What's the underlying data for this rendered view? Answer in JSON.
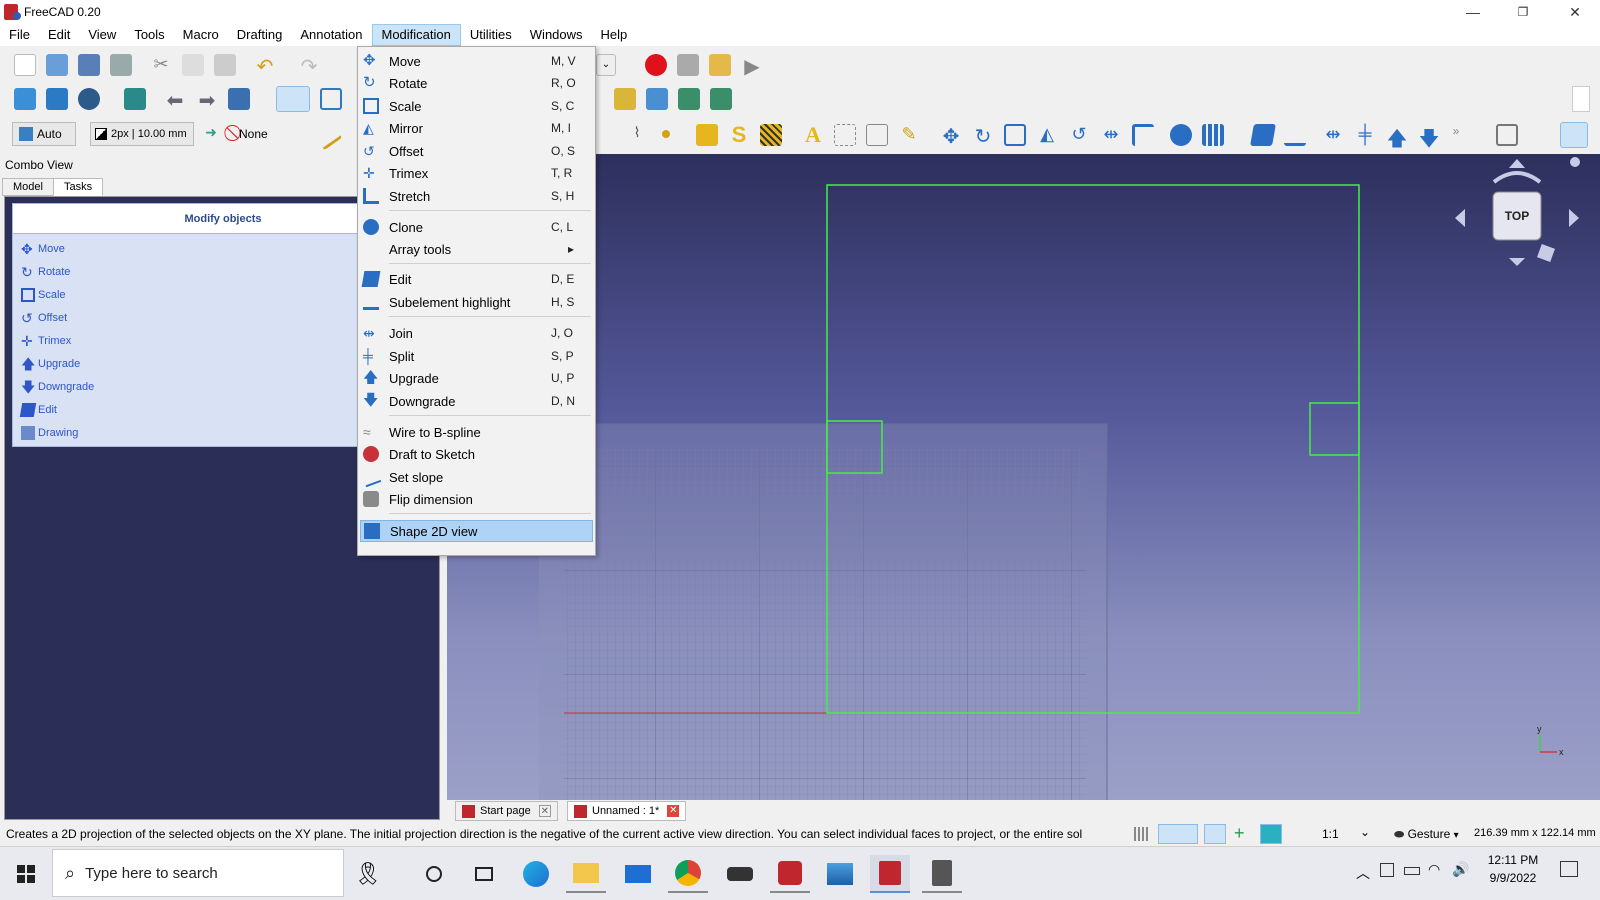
{
  "window": {
    "title": "FreeCAD 0.20",
    "minimize": "—",
    "restore": "❐",
    "close": "✕"
  },
  "menubar": [
    "File",
    "Edit",
    "View",
    "Tools",
    "Macro",
    "Drafting",
    "Annotation",
    "Modification",
    "Utilities",
    "Windows",
    "Help"
  ],
  "active_menu": "Modification",
  "draft_toolbar": {
    "mode": "Auto",
    "linestyle": "2px | 10.00 mm",
    "snap": "None"
  },
  "combo": {
    "title": "Combo View",
    "tabs": [
      "Model",
      "Tasks"
    ],
    "selected_tab": "Tasks",
    "task_header": "Modify objects",
    "tasks": [
      "Move",
      "Rotate",
      "Scale",
      "Offset",
      "Trimex",
      "Upgrade",
      "Downgrade",
      "Edit",
      "Drawing"
    ]
  },
  "dropdown": {
    "items": [
      {
        "label": "Move",
        "shortcut": "M, V",
        "icon": "move-icon"
      },
      {
        "label": "Rotate",
        "shortcut": "R, O",
        "icon": "rotate-icon"
      },
      {
        "label": "Scale",
        "shortcut": "S, C",
        "icon": "scale-icon"
      },
      {
        "label": "Mirror",
        "shortcut": "M, I",
        "icon": "mirror-icon"
      },
      {
        "label": "Offset",
        "shortcut": "O, S",
        "icon": "offset-icon"
      },
      {
        "label": "Trimex",
        "shortcut": "T, R",
        "icon": "trimex-icon"
      },
      {
        "label": "Stretch",
        "shortcut": "S, H",
        "icon": "stretch-icon"
      },
      {
        "label": "Clone",
        "shortcut": "C, L",
        "icon": "clone-icon"
      },
      {
        "label": "Array tools",
        "shortcut": "",
        "icon": ""
      },
      {
        "label": "Edit",
        "shortcut": "D, E",
        "icon": "edit-icon"
      },
      {
        "label": "Subelement highlight",
        "shortcut": "H, S",
        "icon": "subelement-icon"
      },
      {
        "label": "Join",
        "shortcut": "J, O",
        "icon": "join-icon"
      },
      {
        "label": "Split",
        "shortcut": "S, P",
        "icon": "split-icon"
      },
      {
        "label": "Upgrade",
        "shortcut": "U, P",
        "icon": "upgrade-icon"
      },
      {
        "label": "Downgrade",
        "shortcut": "D, N",
        "icon": "downgrade-icon"
      },
      {
        "label": "Wire to B-spline",
        "shortcut": "",
        "icon": "wire-bspline-icon"
      },
      {
        "label": "Draft to Sketch",
        "shortcut": "",
        "icon": "draft-sketch-icon"
      },
      {
        "label": "Set slope",
        "shortcut": "",
        "icon": "slope-icon"
      },
      {
        "label": "Flip dimension",
        "shortcut": "",
        "icon": "flip-dimension-icon"
      },
      {
        "label": "Shape 2D view",
        "shortcut": "",
        "icon": "shape2d-icon"
      }
    ],
    "highlighted": "Shape 2D view",
    "submenu_arrow": "▸"
  },
  "navcube": {
    "face": "TOP"
  },
  "doc_tabs": [
    {
      "label": "Start page",
      "selected": false
    },
    {
      "label": "Unnamed : 1*",
      "selected": true
    }
  ],
  "status": {
    "message": "Creates a 2D projection of the selected objects on the XY plane. The initial projection direction is the negative of the current active view direction. You can select individual faces to project, or the entire sol",
    "scale": "1:1",
    "nav_style": "Gesture",
    "dimensions": "216.39 mm x 122.14 mm"
  },
  "taskbar": {
    "search_placeholder": "Type here to search",
    "time": "12:11 PM",
    "date": "9/9/2022"
  },
  "colors": {
    "accent_green": "#44ee44",
    "menu_highlight": "#aed3f4",
    "task_link": "#2d56c8",
    "view_top": "#2d2f5c",
    "view_bottom": "#9ba0c8"
  }
}
